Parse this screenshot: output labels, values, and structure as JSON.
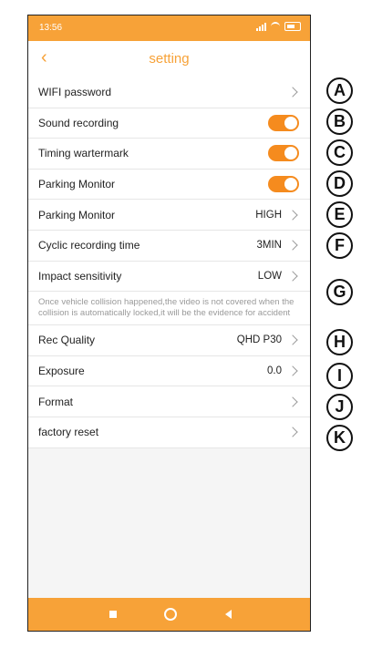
{
  "status_bar": {
    "time": "13:56"
  },
  "header": {
    "title": "setting"
  },
  "rows": [
    {
      "label": "WIFI password",
      "type": "link"
    },
    {
      "label": "Sound recording",
      "type": "toggle",
      "on": true
    },
    {
      "label": "Timing wartermark",
      "type": "toggle",
      "on": true
    },
    {
      "label": "Parking Monitor",
      "type": "toggle",
      "on": true
    },
    {
      "label": "Parking Monitor",
      "type": "link",
      "value": "HIGH"
    },
    {
      "label": "Cyclic recording time",
      "type": "link",
      "value": "3MIN"
    },
    {
      "label": "Impact sensitivity",
      "type": "link",
      "value": "LOW"
    }
  ],
  "note": "Once vehicle collision happened,the video is not covered when the collision is automatically locked,it will be the evidence for accident",
  "rows2": [
    {
      "label": "Rec Quality",
      "type": "link",
      "value": "QHD P30"
    },
    {
      "label": "Exposure",
      "type": "link",
      "value": "0.0"
    },
    {
      "label": "Format",
      "type": "link"
    },
    {
      "label": "factory reset",
      "type": "link"
    }
  ],
  "callouts": [
    "A",
    "B",
    "C",
    "D",
    "E",
    "F",
    "G",
    "H",
    "I",
    "J",
    "K"
  ],
  "colors": {
    "accent": "#f7a238",
    "toggle": "#f58b1e"
  }
}
